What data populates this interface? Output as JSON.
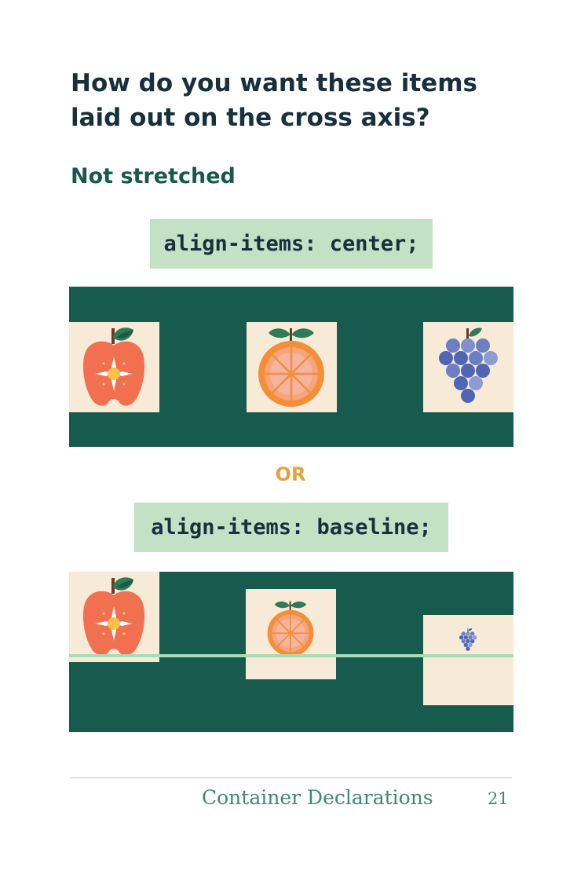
{
  "page": {
    "title": "How do you want these items laid out on the cross axis?",
    "subtitle": "Not stretched"
  },
  "examples": [
    {
      "code": "align-items: center;"
    },
    {
      "code": "align-items: baseline;"
    }
  ],
  "separator": "OR",
  "items": [
    {
      "fruit": "apple-icon",
      "color": "#f07050"
    },
    {
      "fruit": "orange-icon",
      "color": "#f28f38"
    },
    {
      "fruit": "grapes-icon",
      "color": "#5b6fb5"
    }
  ],
  "colors": {
    "container": "#165b4e",
    "item_background": "#f7ead6",
    "code_background": "#c2e1c5",
    "baseline": "#a8dcb6",
    "accent": "#e3a43b"
  },
  "footer": {
    "section": "Container Declarations",
    "page_number": "21"
  }
}
